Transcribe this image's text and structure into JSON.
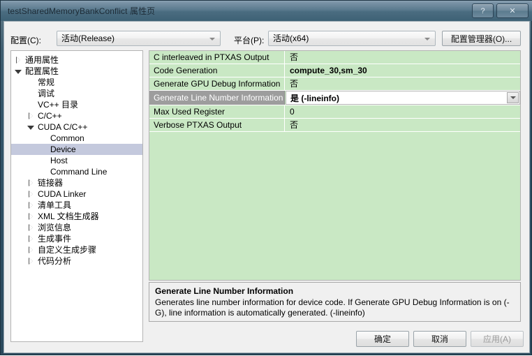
{
  "window": {
    "title": "testSharedMemoryBankConflict 属性页",
    "help_button": "?",
    "close_button": "✕"
  },
  "toolbar": {
    "config_label": "配置(C):",
    "config_value": "活动(Release)",
    "platform_label": "平台(P):",
    "platform_value": "活动(x64)",
    "config_manager_label": "配置管理器(O)..."
  },
  "tree": {
    "items": [
      {
        "label": "通用属性",
        "indent": 0,
        "expander": "closed",
        "selected": false
      },
      {
        "label": "配置属性",
        "indent": 0,
        "expander": "open",
        "selected": false
      },
      {
        "label": "常规",
        "indent": 1,
        "expander": "none",
        "selected": false
      },
      {
        "label": "调试",
        "indent": 1,
        "expander": "none",
        "selected": false
      },
      {
        "label": "VC++ 目录",
        "indent": 1,
        "expander": "none",
        "selected": false
      },
      {
        "label": "C/C++",
        "indent": 1,
        "expander": "closed",
        "selected": false
      },
      {
        "label": "CUDA C/C++",
        "indent": 1,
        "expander": "open",
        "selected": false
      },
      {
        "label": "Common",
        "indent": 2,
        "expander": "none",
        "selected": false
      },
      {
        "label": "Device",
        "indent": 2,
        "expander": "none",
        "selected": true
      },
      {
        "label": "Host",
        "indent": 2,
        "expander": "none",
        "selected": false
      },
      {
        "label": "Command Line",
        "indent": 2,
        "expander": "none",
        "selected": false
      },
      {
        "label": "链接器",
        "indent": 1,
        "expander": "closed",
        "selected": false
      },
      {
        "label": "CUDA Linker",
        "indent": 1,
        "expander": "closed",
        "selected": false
      },
      {
        "label": "清单工具",
        "indent": 1,
        "expander": "closed",
        "selected": false
      },
      {
        "label": "XML 文档生成器",
        "indent": 1,
        "expander": "closed",
        "selected": false
      },
      {
        "label": "浏览信息",
        "indent": 1,
        "expander": "closed",
        "selected": false
      },
      {
        "label": "生成事件",
        "indent": 1,
        "expander": "closed",
        "selected": false
      },
      {
        "label": "自定义生成步骤",
        "indent": 1,
        "expander": "closed",
        "selected": false
      },
      {
        "label": "代码分析",
        "indent": 1,
        "expander": "closed",
        "selected": false
      }
    ]
  },
  "grid": {
    "rows": [
      {
        "name": "C interleaved in PTXAS Output",
        "value": "否",
        "bold": false,
        "selected": false
      },
      {
        "name": "Code Generation",
        "value": "compute_30,sm_30",
        "bold": true,
        "selected": false
      },
      {
        "name": "Generate GPU Debug Information",
        "value": "否",
        "bold": false,
        "selected": false
      },
      {
        "name": "Generate Line Number Information",
        "value": "是 (-lineinfo)",
        "bold": true,
        "selected": true
      },
      {
        "name": "Max Used Register",
        "value": "0",
        "bold": false,
        "selected": false
      },
      {
        "name": "Verbose PTXAS Output",
        "value": "否",
        "bold": false,
        "selected": false
      }
    ]
  },
  "description": {
    "title": "Generate Line Number Information",
    "body": "Generates line number information for device code.  If Generate GPU Debug Information is on (-G), line information is automatically generated. (-lineinfo)"
  },
  "footer": {
    "ok_label": "确定",
    "cancel_label": "取消",
    "apply_label": "应用(A)"
  },
  "colors": {
    "grid_background": "#c9e8c4",
    "selected_row": "#9d9d9d",
    "tree_selection": "#c4c9dd",
    "titlebar": "#4a6c80"
  }
}
